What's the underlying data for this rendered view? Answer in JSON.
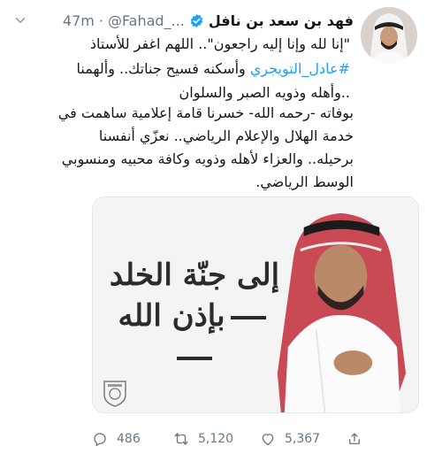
{
  "author": {
    "display_name": "فهد بن سعد بن نافل",
    "handle": "@Fahad_...",
    "separator": "·",
    "time": "47m"
  },
  "tweet": {
    "line1": "\"إنا لله وإنا إليه راجعون\".. اللهم اغفر للأستاذ",
    "line2_hashtag": "#عادل_التويجري",
    "line2_rest": " وأسكنه فسيح جناتك.. وألهمنا",
    "line3": "..وأهله وذويه الصبر والسلوان",
    "line4": "بوفاته -رحمه الله- خسرنا قامة إعلامية ساهمت في",
    "line5": "خدمة الهلال والإعلام الرياضي.. نعزّي أنفسنا",
    "line6": "برحيله.. والعزاء لأهله وذويه وكافة محبيه ومنسوبي",
    "line7": "الوسط الرياضي."
  },
  "media": {
    "headline_line1": "إلى جنّة الخلد",
    "headline_line2": "بإذن الله",
    "club_logo": "al-hilal-logo"
  },
  "actions": {
    "replies": "486",
    "retweets": "5,120",
    "likes": "5,367"
  },
  "colors": {
    "link": "#1da1f2",
    "muted": "#657786",
    "text": "#14171a",
    "verified": "#1da1f2"
  }
}
